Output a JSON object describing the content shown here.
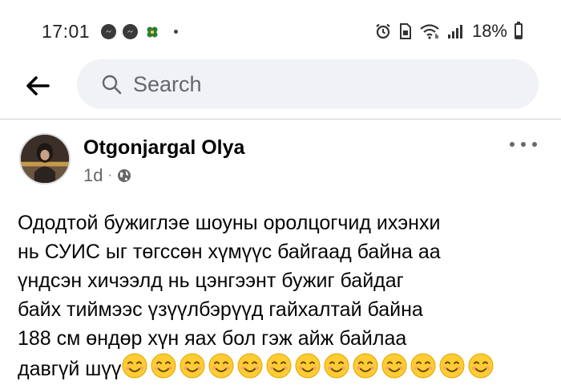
{
  "status_bar": {
    "time": "17:01",
    "battery_percent": "18%",
    "battery_level": 0.18
  },
  "header": {
    "back_icon": "arrow-left-icon",
    "search_placeholder": "Search"
  },
  "post": {
    "author": "Otgonjargal Olya",
    "time_ago": "1d",
    "separator": "·",
    "privacy_icon": "globe-icon",
    "text_lines": [
      "Ододтой бужиглэе шоуны оролцогчид ихэнхи",
      "нь СУИС ыг төгссөн хүмүүс байгаад байна аа",
      "үндсэн хичээлд нь цэнгээнт бужиг байдаг",
      "байх тиймээс үзүүлбэрүүд гайхалтай байна",
      "188 см өндөр хүн яах бол гэж айж байлаа",
      "давгүй шүү"
    ],
    "emoji_count": 13,
    "emoji_icon": "smiling-face-emoji-icon"
  }
}
